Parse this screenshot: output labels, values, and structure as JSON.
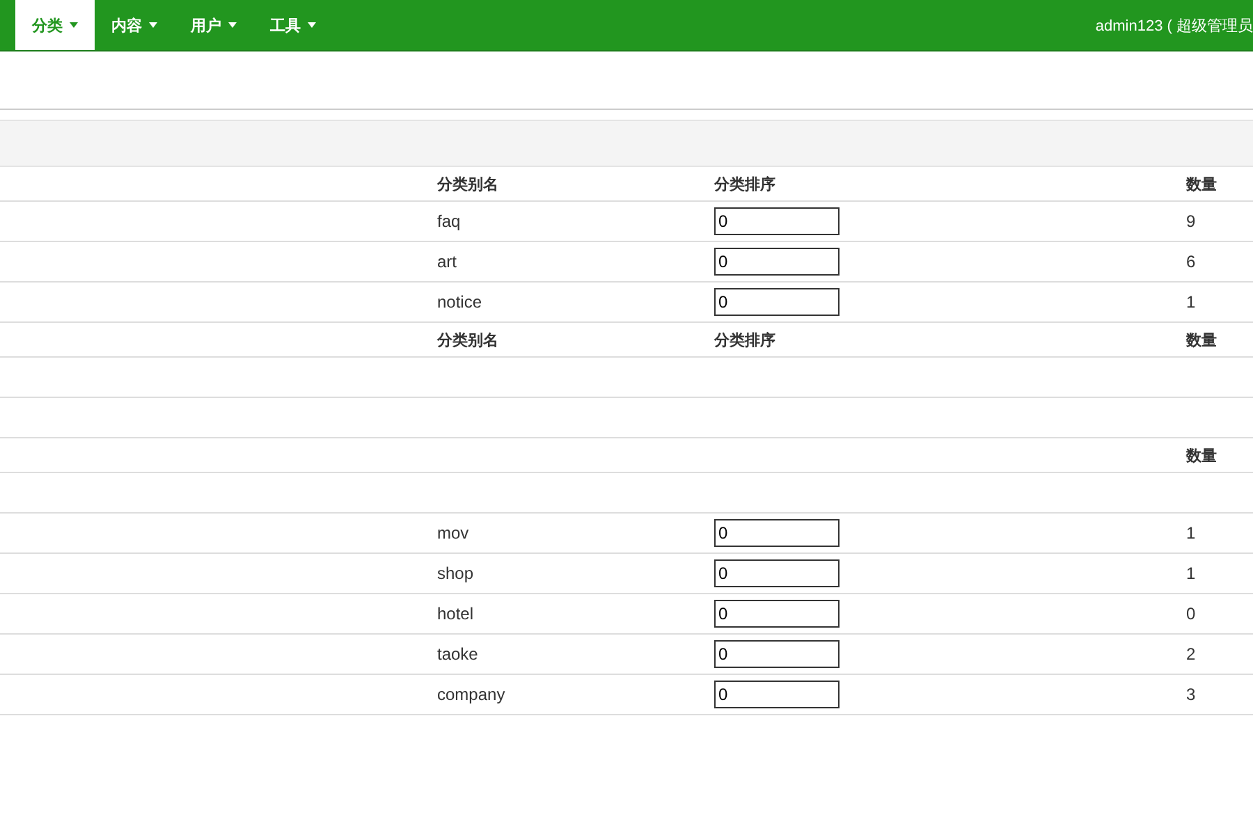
{
  "navbar": {
    "items": [
      {
        "label": "分类",
        "selected": true
      },
      {
        "label": "内容",
        "selected": false
      },
      {
        "label": "用户",
        "selected": false
      },
      {
        "label": "工具",
        "selected": false
      }
    ],
    "user": "admin123 ( 超级管理员"
  },
  "sections": [
    {
      "header": {
        "alias": "分类别名",
        "sort": "分类排序",
        "count": "数量"
      },
      "rows": [
        {
          "kind": "item",
          "alias": "faq",
          "sort_value": "0",
          "count": "9"
        },
        {
          "kind": "item",
          "alias": "art",
          "sort_value": "0",
          "count": "6"
        },
        {
          "kind": "item",
          "alias": "notice",
          "sort_value": "0",
          "count": "1"
        }
      ]
    },
    {
      "header": {
        "alias": "分类别名",
        "sort": "分类排序",
        "count": "数量"
      },
      "rows": [
        {
          "kind": "blank"
        },
        {
          "kind": "blank"
        }
      ]
    },
    {
      "header": {
        "count": "数量"
      },
      "rows": [
        {
          "kind": "blank"
        },
        {
          "kind": "item",
          "alias": "mov",
          "sort_value": "0",
          "count": "1"
        },
        {
          "kind": "item",
          "alias": "shop",
          "sort_value": "0",
          "count": "1"
        },
        {
          "kind": "item",
          "alias": "hotel",
          "sort_value": "0",
          "count": "0"
        },
        {
          "kind": "item",
          "alias": "taoke",
          "sort_value": "0",
          "count": "2"
        },
        {
          "kind": "item",
          "alias": "company",
          "sort_value": "0",
          "count": "3"
        }
      ]
    }
  ]
}
